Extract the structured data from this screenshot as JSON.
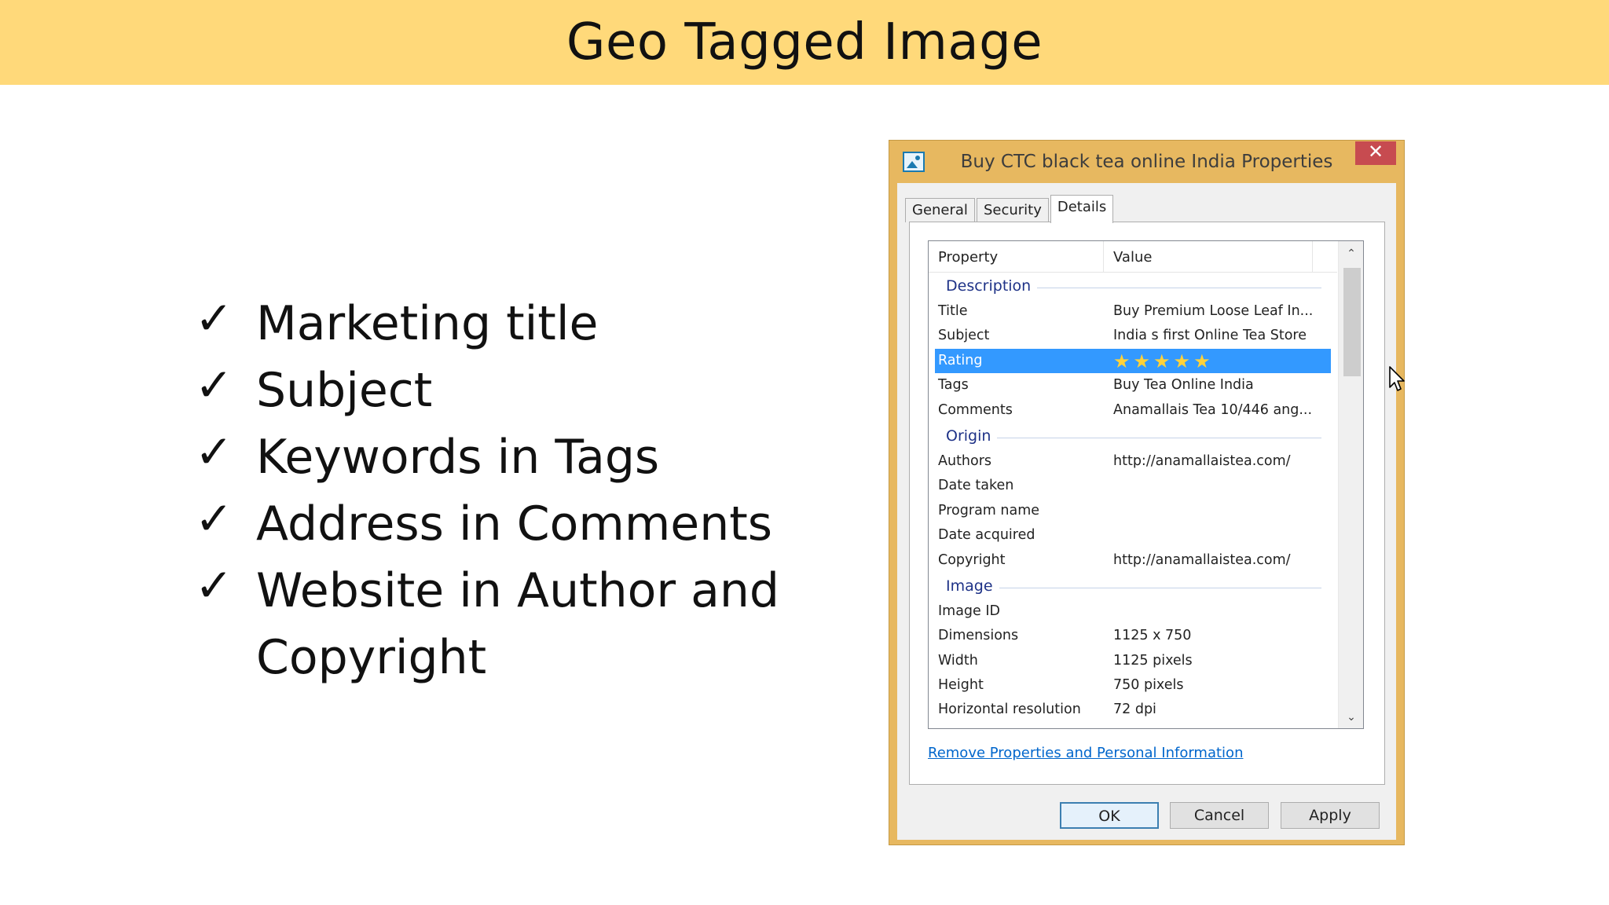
{
  "slide": {
    "title": "Geo Tagged Image",
    "bullets": [
      "Marketing title",
      "Subject",
      "Keywords in Tags",
      "Address in Comments",
      "Website in Author and Copyright"
    ],
    "check_glyph": "✓"
  },
  "dialog": {
    "title": "Buy CTC black tea online India Properties",
    "close_label": "✕",
    "tabs": [
      {
        "label": "General",
        "active": false
      },
      {
        "label": "Security",
        "active": false
      },
      {
        "label": "Details",
        "active": true
      }
    ],
    "columns": {
      "property": "Property",
      "value": "Value"
    },
    "groups": [
      {
        "name": "Description",
        "rows": [
          {
            "key": "Title",
            "value": "Buy Premium Loose Leaf In..."
          },
          {
            "key": "Subject",
            "value": "India s first Online Tea Store"
          },
          {
            "key": "Rating",
            "value": "★★★★★",
            "selected": true
          },
          {
            "key": "Tags",
            "value": "Buy Tea Online India"
          },
          {
            "key": "Comments",
            "value": "Anamallais Tea 10/446 ang..."
          }
        ]
      },
      {
        "name": "Origin",
        "rows": [
          {
            "key": "Authors",
            "value": "http://anamallaistea.com/"
          },
          {
            "key": "Date taken",
            "value": ""
          },
          {
            "key": "Program name",
            "value": ""
          },
          {
            "key": "Date acquired",
            "value": ""
          },
          {
            "key": "Copyright",
            "value": "http://anamallaistea.com/"
          }
        ]
      },
      {
        "name": "Image",
        "rows": [
          {
            "key": "Image ID",
            "value": ""
          },
          {
            "key": "Dimensions",
            "value": "1125 x 750"
          },
          {
            "key": "Width",
            "value": "1125 pixels"
          },
          {
            "key": "Height",
            "value": "750 pixels"
          },
          {
            "key": "Horizontal resolution",
            "value": "72 dpi"
          }
        ]
      }
    ],
    "remove_link": "Remove Properties and Personal Information",
    "buttons": {
      "ok": "OK",
      "cancel": "Cancel",
      "apply": "Apply"
    },
    "scroll": {
      "up": "⌃",
      "down": "⌄"
    },
    "rating_stars": 5
  },
  "colors": {
    "banner": "#ffd97a",
    "dialog_frame": "#e7b860",
    "selection": "#3399ff",
    "link": "#0066cc",
    "group_header": "#1e3287",
    "close_button": "#c74b50"
  }
}
